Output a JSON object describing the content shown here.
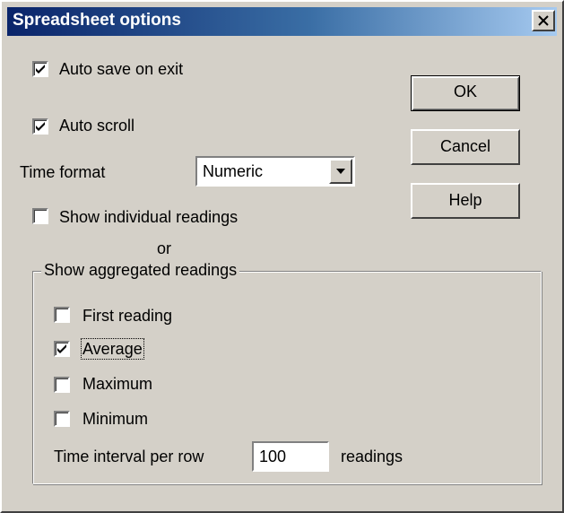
{
  "dialog": {
    "title": "Spreadsheet options"
  },
  "options": {
    "auto_save": {
      "label": "Auto save on exit",
      "checked": true
    },
    "auto_scroll": {
      "label": "Auto scroll",
      "checked": true
    },
    "time_format": {
      "label": "Time format",
      "value": "Numeric"
    },
    "show_individual": {
      "label": "Show individual readings",
      "checked": false
    },
    "or_label": "or"
  },
  "aggregated": {
    "legend": "Show aggregated readings",
    "items": [
      {
        "label": "First reading",
        "checked": false
      },
      {
        "label": "Average",
        "checked": true
      },
      {
        "label": "Maximum",
        "checked": false
      },
      {
        "label": "Minimum",
        "checked": false
      }
    ],
    "interval_label": "Time interval per row",
    "interval_value": "100",
    "interval_unit": "readings"
  },
  "buttons": {
    "ok": "OK",
    "cancel": "Cancel",
    "help": "Help"
  },
  "icons": {
    "close": "close-icon",
    "dropdown": "chevron-down-icon",
    "check": "checkmark-icon"
  },
  "colors": {
    "dialog_face": "#d4d0c8",
    "title_start": "#0a246a",
    "title_end": "#a6caf0"
  }
}
